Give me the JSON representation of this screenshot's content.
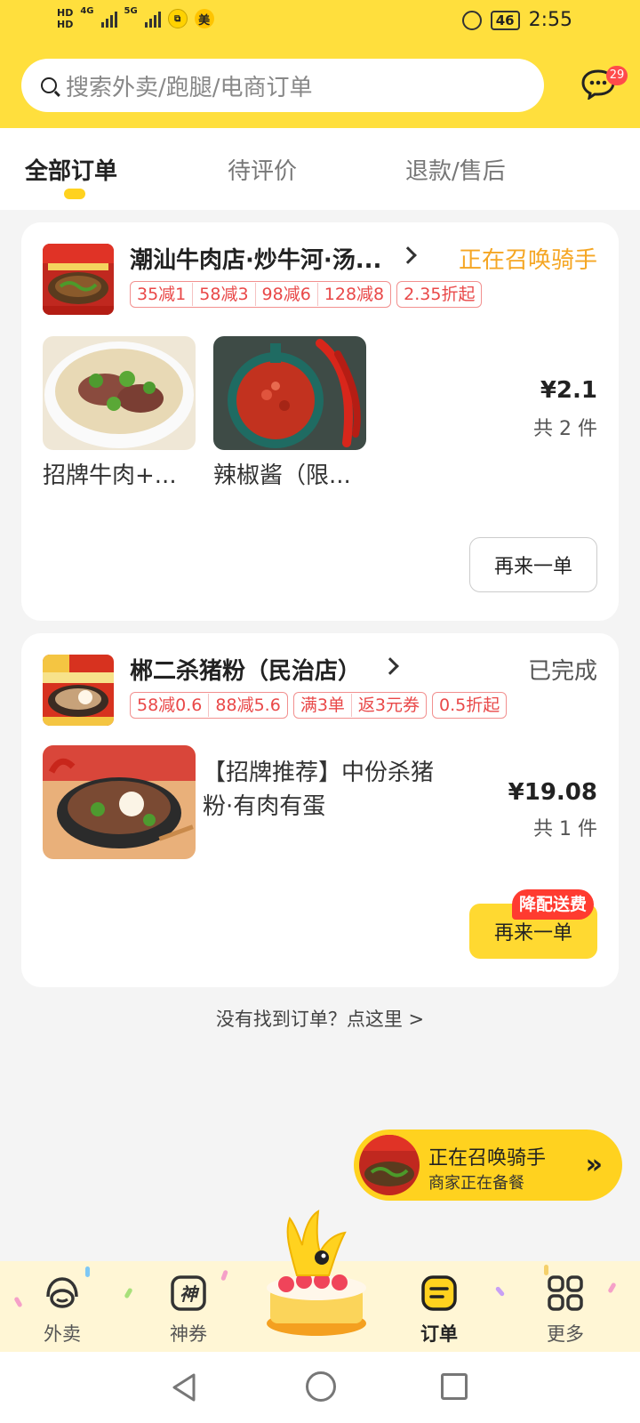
{
  "status_bar": {
    "hd1": "HD",
    "hd2": "HD",
    "net1": "4G",
    "net2": "5G",
    "app_badge": "美",
    "battery": "46",
    "time": "2:55"
  },
  "header": {
    "search_placeholder": "搜索外卖/跑腿/电商订单",
    "message_badge": "29"
  },
  "tabs": [
    {
      "label": "全部订单",
      "active": true
    },
    {
      "label": "待评价",
      "active": false
    },
    {
      "label": "退款/售后",
      "active": false
    }
  ],
  "orders": [
    {
      "shop_name": "潮汕牛肉店·炒牛河·汤...",
      "status": "正在召唤骑手",
      "status_color": "#f5a623",
      "promos": [
        [
          "35减1",
          "58减3",
          "98减6",
          "128减8"
        ],
        [
          "2.35折起"
        ]
      ],
      "items": [
        {
          "name": "招牌牛肉+..."
        },
        {
          "name": "辣椒酱（限..."
        }
      ],
      "price": "¥2.1",
      "count": "共 2 件",
      "reorder_label": "再来一单"
    },
    {
      "shop_name": "郴二杀猪粉（民治店）",
      "status": "已完成",
      "status_color": "#555555",
      "promos": [
        [
          "58减0.6",
          "88减5.6"
        ],
        [
          "满3单",
          "返3元券"
        ],
        [
          "0.5折起"
        ]
      ],
      "item_name": "【招牌推荐】中份杀猪粉·有肉有蛋",
      "price": "¥19.08",
      "count": "共 1 件",
      "reorder_label": "再来一单",
      "fee_tag": "降配送费"
    }
  ],
  "not_found_link": "没有找到订单？点这里 >",
  "rider_float": {
    "title": "正在召唤骑手",
    "subtitle": "商家正在备餐",
    "arrows": "»"
  },
  "bottom_nav": [
    {
      "label": "外卖",
      "icon": "takeout-icon",
      "active": false
    },
    {
      "label": "神券",
      "icon": "coupon-icon",
      "active": false
    },
    {
      "label": "订单",
      "icon": "order-icon",
      "active": true
    },
    {
      "label": "更多",
      "icon": "more-grid-icon",
      "active": false
    }
  ],
  "colors": {
    "brand_yellow": "#ffdf3d",
    "promo_red": "#e94848",
    "status_orange": "#f5a623"
  }
}
